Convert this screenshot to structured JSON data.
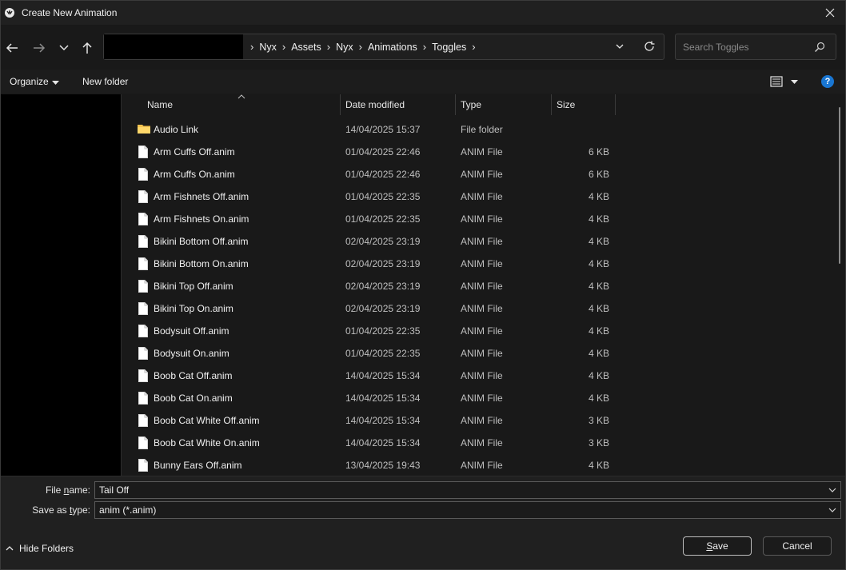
{
  "window": {
    "title": "Create New Animation"
  },
  "address": {
    "crumbs": [
      "Nyx",
      "Assets",
      "Nyx",
      "Animations",
      "Toggles"
    ]
  },
  "search": {
    "placeholder": "Search Toggles"
  },
  "toolbar": {
    "organize_label": "Organize",
    "new_folder_label": "New folder"
  },
  "columns": {
    "name": "Name",
    "date": "Date modified",
    "type": "Type",
    "size": "Size"
  },
  "files": [
    {
      "name": "Audio Link",
      "date": "14/04/2025 15:37",
      "type": "File folder",
      "size": "",
      "icon": "folder-icon"
    },
    {
      "name": "Arm Cuffs Off.anim",
      "date": "01/04/2025 22:46",
      "type": "ANIM File",
      "size": "6 KB",
      "icon": "file-icon"
    },
    {
      "name": "Arm Cuffs On.anim",
      "date": "01/04/2025 22:46",
      "type": "ANIM File",
      "size": "6 KB",
      "icon": "file-icon"
    },
    {
      "name": "Arm Fishnets Off.anim",
      "date": "01/04/2025 22:35",
      "type": "ANIM File",
      "size": "4 KB",
      "icon": "file-icon"
    },
    {
      "name": "Arm Fishnets On.anim",
      "date": "01/04/2025 22:35",
      "type": "ANIM File",
      "size": "4 KB",
      "icon": "file-icon"
    },
    {
      "name": "Bikini Bottom Off.anim",
      "date": "02/04/2025 23:19",
      "type": "ANIM File",
      "size": "4 KB",
      "icon": "file-icon"
    },
    {
      "name": "Bikini Bottom On.anim",
      "date": "02/04/2025 23:19",
      "type": "ANIM File",
      "size": "4 KB",
      "icon": "file-icon"
    },
    {
      "name": "Bikini Top Off.anim",
      "date": "02/04/2025 23:19",
      "type": "ANIM File",
      "size": "4 KB",
      "icon": "file-icon"
    },
    {
      "name": "Bikini Top On.anim",
      "date": "02/04/2025 23:19",
      "type": "ANIM File",
      "size": "4 KB",
      "icon": "file-icon"
    },
    {
      "name": "Bodysuit Off.anim",
      "date": "01/04/2025 22:35",
      "type": "ANIM File",
      "size": "4 KB",
      "icon": "file-icon"
    },
    {
      "name": "Bodysuit On.anim",
      "date": "01/04/2025 22:35",
      "type": "ANIM File",
      "size": "4 KB",
      "icon": "file-icon"
    },
    {
      "name": "Boob Cat Off.anim",
      "date": "14/04/2025 15:34",
      "type": "ANIM File",
      "size": "4 KB",
      "icon": "file-icon"
    },
    {
      "name": "Boob Cat On.anim",
      "date": "14/04/2025 15:34",
      "type": "ANIM File",
      "size": "4 KB",
      "icon": "file-icon"
    },
    {
      "name": "Boob Cat White Off.anim",
      "date": "14/04/2025 15:34",
      "type": "ANIM File",
      "size": "3 KB",
      "icon": "file-icon"
    },
    {
      "name": "Boob Cat White On.anim",
      "date": "14/04/2025 15:34",
      "type": "ANIM File",
      "size": "3 KB",
      "icon": "file-icon"
    },
    {
      "name": "Bunny Ears Off.anim",
      "date": "13/04/2025 19:43",
      "type": "ANIM File",
      "size": "4 KB",
      "icon": "file-icon"
    }
  ],
  "form": {
    "file_name_label_pre": "File ",
    "file_name_label_key": "n",
    "file_name_label_post": "ame:",
    "file_name_value": "Tail Off",
    "save_type_label_pre": "Save as ",
    "save_type_label_key": "t",
    "save_type_label_post": "ype:",
    "save_type_value": "anim (*.anim)"
  },
  "footer": {
    "hide_folders_label": "Hide Folders",
    "save_key": "S",
    "save_rest": "ave",
    "cancel_label": "Cancel"
  },
  "colors": {
    "help": "#1976d2",
    "folder": "#f2c14e"
  }
}
